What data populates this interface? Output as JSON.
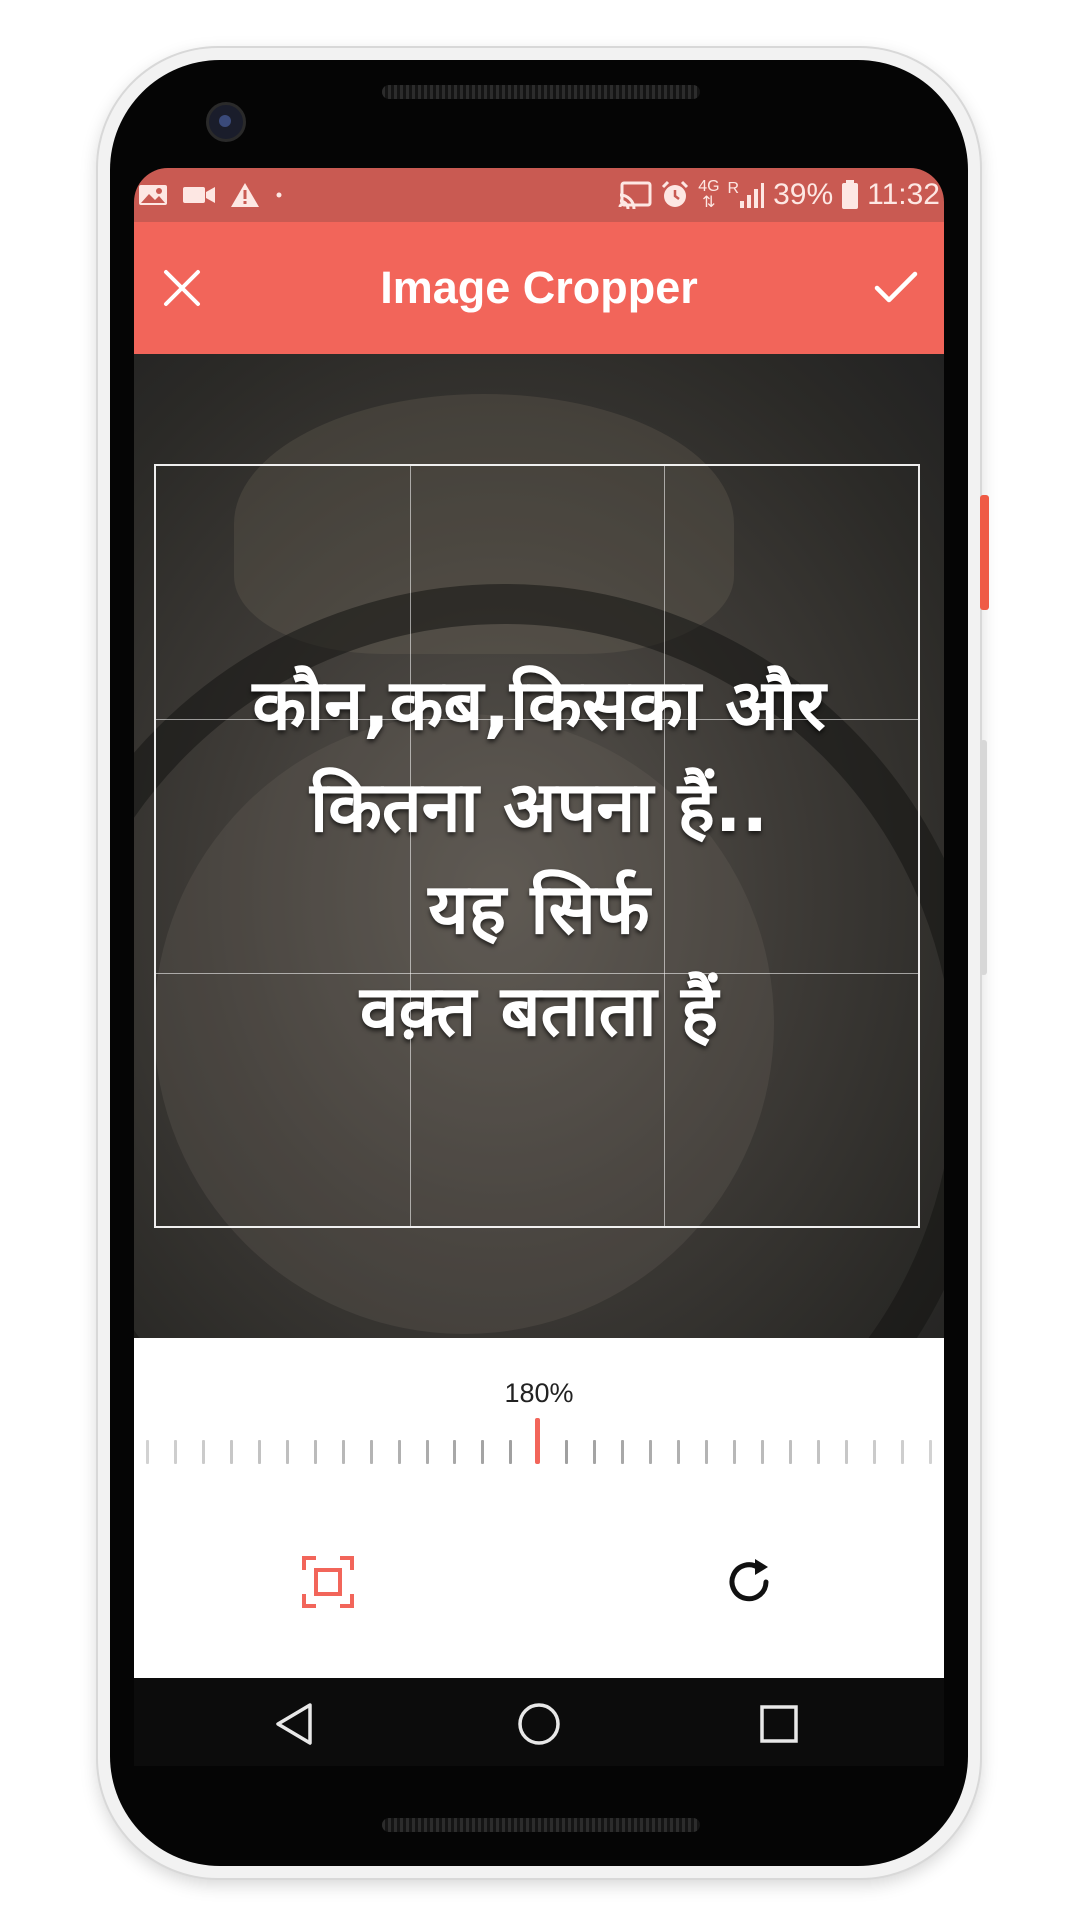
{
  "status_bar": {
    "battery": "39%",
    "time": "11:32",
    "network": "4G",
    "roaming": "R",
    "icons_left": [
      "gallery-icon",
      "video-icon",
      "warning-icon",
      "dot-icon"
    ],
    "icons_right": [
      "cast-icon",
      "alarm-icon",
      "network-4g-icon",
      "signal-icon",
      "battery-icon"
    ]
  },
  "app_bar": {
    "title": "Image Cropper",
    "close_icon": "close-icon",
    "confirm_icon": "check-icon",
    "color": "#f2655a"
  },
  "image": {
    "quote_lines": [
      "कौन,कब,किसका और",
      "कितना अपना हैं..",
      "यह सिर्फ",
      "वक़्त बताता हैं"
    ]
  },
  "controls": {
    "zoom_label": "180%",
    "accent_color": "#f2655a"
  },
  "tools": {
    "crop_icon": "crop-frame-icon",
    "rotate_icon": "rotate-icon"
  },
  "nav_bar": {
    "back_icon": "back-triangle-icon",
    "home_icon": "home-circle-icon",
    "recent_icon": "recents-square-icon"
  }
}
